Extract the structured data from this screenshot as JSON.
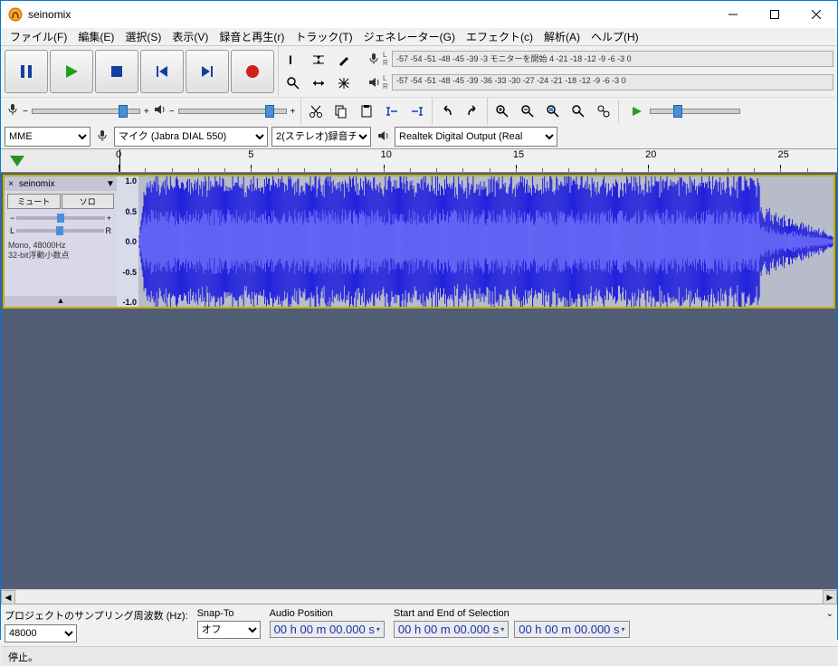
{
  "window": {
    "title": "seinomix"
  },
  "menu": {
    "items": [
      "ファイル(F)",
      "編集(E)",
      "選択(S)",
      "表示(V)",
      "録音と再生(r)",
      "トラック(T)",
      "ジェネレーター(G)",
      "エフェクト(c)",
      "解析(A)",
      "ヘルプ(H)"
    ]
  },
  "meter": {
    "record_text": "-57 -54 -51 -48 -45    -39 -3 モニターを開始 4 -21 -18    -12  -9  -6  -3  0",
    "play_text": "-57 -54 -51 -48 -45    -39 -36 -33 -30 -27 -24 -21 -18    -12  -9  -6  -3  0"
  },
  "devices": {
    "host": "MME",
    "input": "マイク (Jabra DIAL 550)",
    "channels": "2(ステレオ)録音チ",
    "output": "Realtek Digital Output (Real"
  },
  "timeline": {
    "ticks": [
      "0",
      "5",
      "10",
      "15",
      "20",
      "25"
    ]
  },
  "track": {
    "name": "seinomix",
    "mute": "ミュート",
    "solo": "ソロ",
    "pan_l": "L",
    "pan_r": "R",
    "info1": "Mono, 48000Hz",
    "info2": "32-bit浮動小数点",
    "amp_labels": [
      "1.0",
      "0.5",
      "0.0",
      "-0.5",
      "-1.0"
    ]
  },
  "status": {
    "rate_label": "プロジェクトのサンプリング周波数 (Hz):",
    "rate_value": "48000",
    "snap_label": "Snap-To",
    "snap_value": "オフ",
    "pos_label": "Audio Position",
    "pos_value": "00 h 00 m 00.000 s",
    "sel_label": "Start and End of Selection",
    "sel_start": "00 h 00 m 00.000 s",
    "sel_end": "00 h 00 m 00.000 s",
    "message": "停止。"
  },
  "gain_minus": "−",
  "gain_plus": "+"
}
